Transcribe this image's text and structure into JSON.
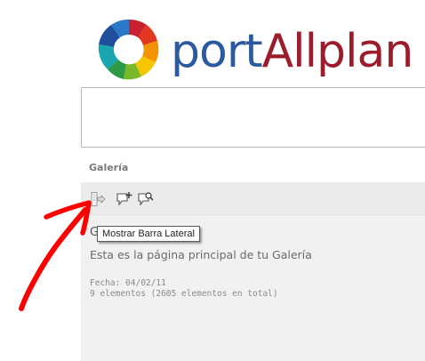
{
  "logo": {
    "text_port": "port",
    "text_allplan": "Allplan"
  },
  "section": {
    "heading": "Galería"
  },
  "toolbar": {
    "buttons": [
      {
        "icon": "sidebar-toggle-icon"
      },
      {
        "icon": "add-comment-icon"
      },
      {
        "icon": "search-comment-icon"
      }
    ],
    "tooltip": "Mostrar Barra Lateral"
  },
  "gallery": {
    "title_partial": "G",
    "description": "Esta es la página principal de tu Galería",
    "date_line": "Fecha: 04/02/11",
    "count_line": "9 elementos (2605 elementos en total)"
  },
  "colors": {
    "logo_port": "#2c5aa0",
    "logo_allplan": "#9c1c2c",
    "annotation": "#ff0000",
    "panel_bg": "#f1f1f1"
  }
}
